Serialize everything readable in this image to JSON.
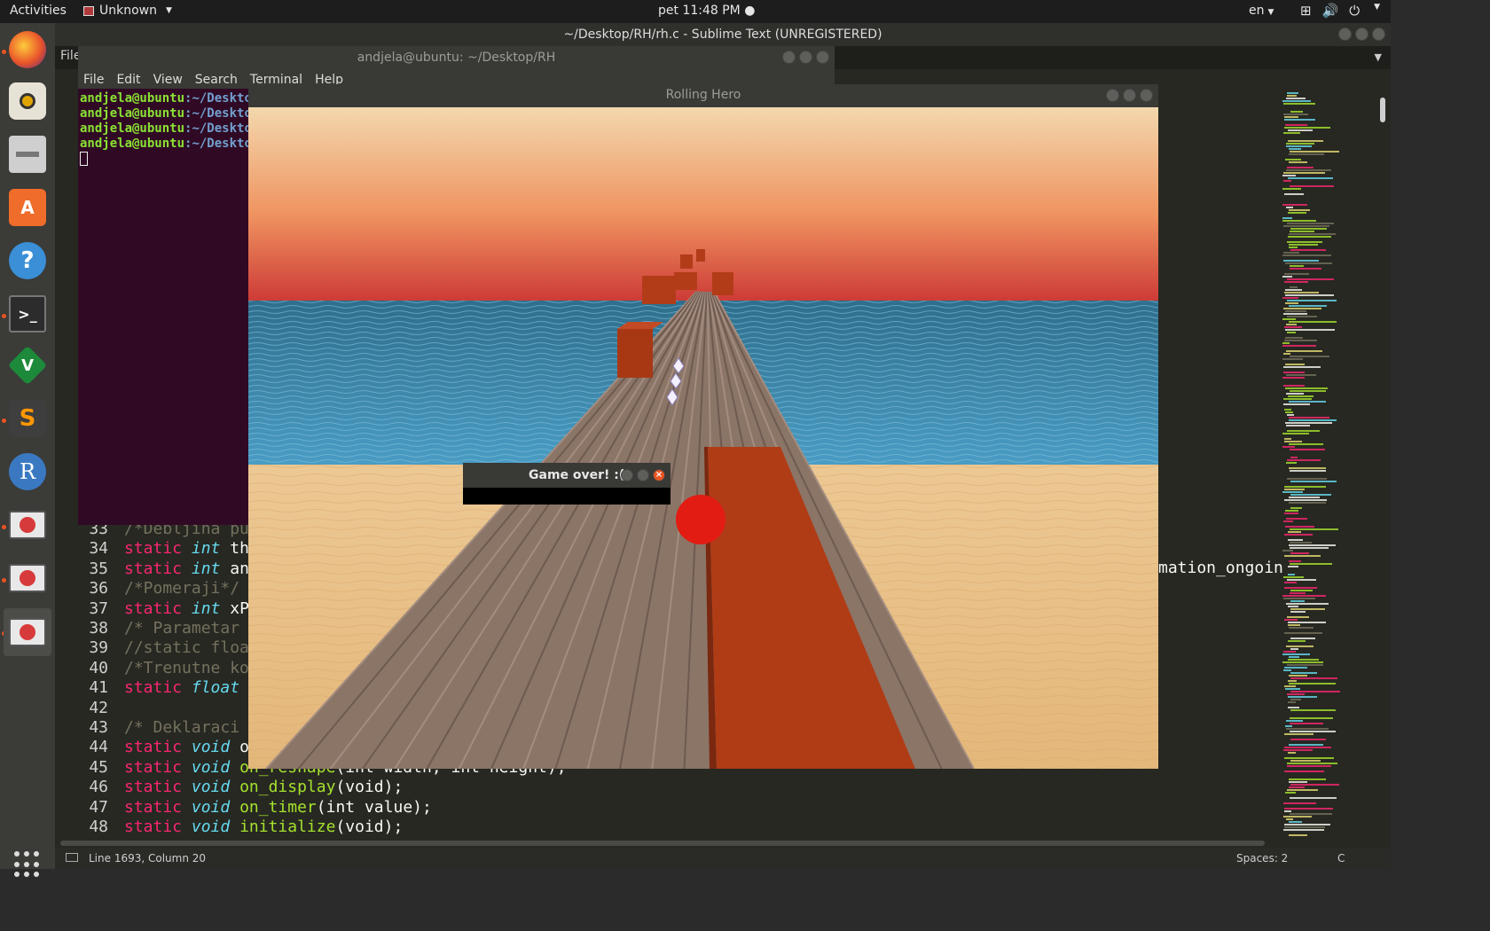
{
  "topbar": {
    "activities": "Activities",
    "app_menu": "Unknown",
    "clock": "pet 11:48 PM ●",
    "lang": "en",
    "tray_icons": [
      "network-icon",
      "volume-icon",
      "power-icon"
    ]
  },
  "dock": {
    "items": [
      "firefox",
      "rhythmbox",
      "files",
      "software",
      "help",
      "terminal",
      "vim",
      "sublime-text",
      "r",
      "blocked-app",
      "blocked-app",
      "blocked-app"
    ]
  },
  "sublime": {
    "title": "~/Desktop/RH/rh.c - Sublime Text (UNREGISTERED)",
    "file_menu": "File",
    "code_lines": [
      {
        "num": "33",
        "text": "/*Debljina pu"
      },
      {
        "num": "34",
        "kw": "static",
        "ty": "int",
        "rest": "th"
      },
      {
        "num": "35",
        "kw": "static",
        "ty": "int",
        "rest": "an"
      },
      {
        "num": "36",
        "text": "/*Pomeraji*/"
      },
      {
        "num": "37",
        "kw": "static",
        "ty": "int",
        "rest": "xP"
      },
      {
        "num": "38",
        "text": "/* Parametar"
      },
      {
        "num": "39",
        "text": "//static floa"
      },
      {
        "num": "40",
        "text": "/*Trenutne ko"
      },
      {
        "num": "41",
        "kw": "static",
        "ty": "float",
        "rest": ""
      },
      {
        "num": "42",
        "text": ""
      },
      {
        "num": "43",
        "text": "/* Deklaraci"
      },
      {
        "num": "44",
        "kw": "static",
        "ty": "void",
        "rest": "o"
      },
      {
        "num": "45",
        "kw": "static",
        "ty": "void",
        "fn": "on_reshape",
        "args": "(int width, int height);"
      },
      {
        "num": "46",
        "kw": "static",
        "ty": "void",
        "fn": "on_display",
        "args": "(void);"
      },
      {
        "num": "47",
        "kw": "static",
        "ty": "void",
        "fn": "on_timer",
        "args": "(int value);"
      },
      {
        "num": "48",
        "kw": "static",
        "ty": "void",
        "fn": "initialize",
        "args": "(void);"
      }
    ],
    "tail_text": "mation_ongoin",
    "status_position": "Line 1693, Column 20",
    "status_spaces": "Spaces: 2",
    "status_syntax": "C"
  },
  "terminal": {
    "title": "andjela@ubuntu: ~/Desktop/RH",
    "menu": [
      "File",
      "Edit",
      "View",
      "Search",
      "Terminal",
      "Help"
    ],
    "prompt_user": "andjela@ubuntu",
    "prompt_path": ":~/Deskto",
    "prompt_count": 4
  },
  "game": {
    "title": "Rolling Hero",
    "dialog_title": "Game over! :("
  },
  "colors": {
    "sky_top": "#f1d3a4",
    "sky_bottom": "#d2443a",
    "sea": "#3f7d9d",
    "sand": "#e8c184",
    "plank": "#8a7468",
    "obstacle": "#b23c18",
    "ball": "#e81e14"
  }
}
